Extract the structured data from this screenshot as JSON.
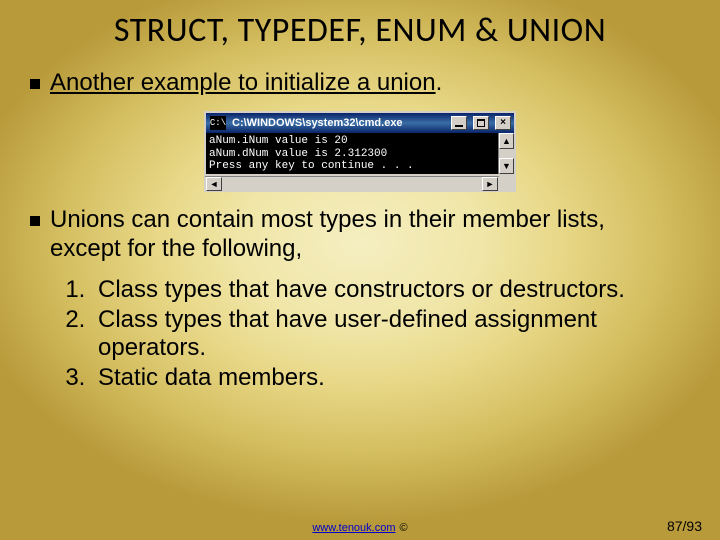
{
  "title": "STRUCT, TYPEDEF, ENUM & UNION",
  "bullet_link": "Another example to initialize a union",
  "bullet_link_suffix": ".",
  "console": {
    "icon_text": "C:\\",
    "title": "C:\\WINDOWS\\system32\\cmd.exe",
    "lines": [
      "aNum.iNum value is 20",
      "aNum.dNum value is 2.312300",
      "Press any key to continue . . ."
    ],
    "arrow_up": "▲",
    "arrow_down": "▼",
    "arrow_left": "◄",
    "arrow_right": "►"
  },
  "bullet_body": "Unions can contain most types in their member lists, except for the following,",
  "items": [
    "Class types that have constructors or destructors.",
    "Class types that have user-defined assignment operators.",
    "Static data members."
  ],
  "footer_url": "www.tenouk.com",
  "footer_copy": "©",
  "page": "87/93"
}
